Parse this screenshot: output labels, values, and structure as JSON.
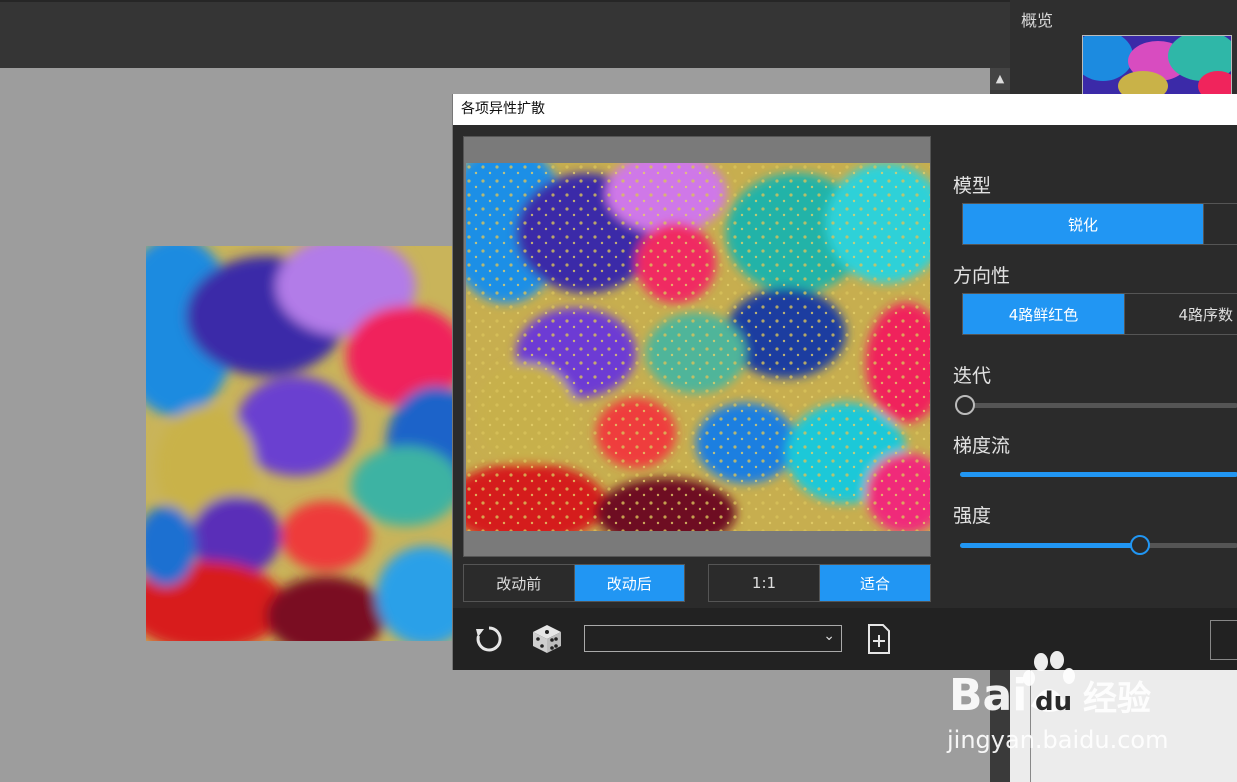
{
  "overview": {
    "title": "概览"
  },
  "dialog": {
    "title": "各项异性扩散",
    "compare": {
      "before": "改动前",
      "after": "改动后",
      "active": "after"
    },
    "zoom": {
      "one_to_one": "1:1",
      "fit": "适合",
      "active": "fit"
    },
    "model": {
      "label": "模型",
      "options": [
        "锐化",
        ""
      ],
      "active_index": 0
    },
    "direction": {
      "label": "方向性",
      "options": [
        "4路鲜红色",
        "4路序数"
      ],
      "active_index": 0
    },
    "iterations": {
      "label": "迭代",
      "value_fraction": 0.0
    },
    "gradient_flow": {
      "label": "梯度流",
      "value_fraction": 1.0
    },
    "strength": {
      "label": "强度",
      "value_fraction": 0.64
    },
    "preset_dropdown": {
      "value": ""
    }
  },
  "icons": {
    "reset": "reset-icon",
    "random": "dice-icon",
    "add_preset": "add-file-icon",
    "chevron": "chevron-down-icon"
  },
  "watermark": {
    "brand": "Bai",
    "brand2": "du",
    "cn": "经验",
    "url": "jingyan.baidu.com"
  },
  "colors": {
    "accent": "#2196f3",
    "panel": "#2b2b2b",
    "canvas": "#9d9d9d"
  }
}
